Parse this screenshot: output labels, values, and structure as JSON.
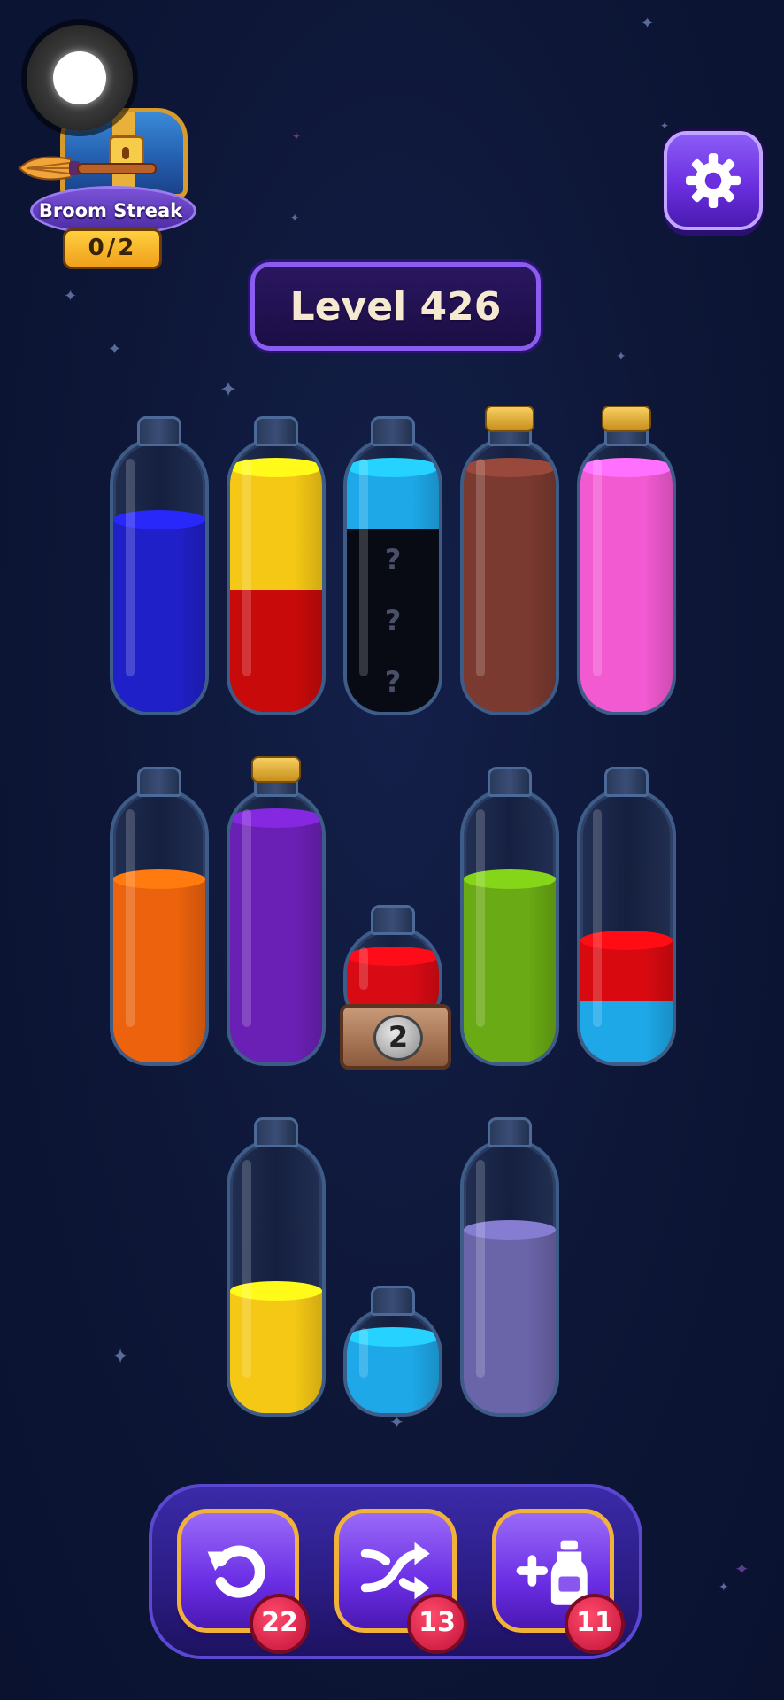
{
  "header": {
    "streak_label": "Broom Streak",
    "streak_count": "0/2",
    "level_label": "Level 426"
  },
  "icons": {
    "settings": "gear-icon",
    "undo": "undo-icon",
    "shuffle": "shuffle-icon",
    "add_bottle": "add-bottle-icon",
    "record": "record-icon",
    "chest": "treasure-chest-icon"
  },
  "bottles": [
    {
      "id": "b1",
      "corked": false,
      "capacity": 4,
      "layers": [
        {
          "color": "#2020c8",
          "units": 3.15
        }
      ]
    },
    {
      "id": "b2",
      "corked": false,
      "capacity": 4,
      "layers": [
        {
          "color": "#c80a0a",
          "units": 2
        },
        {
          "color": "#f5c815",
          "units": 2
        }
      ]
    },
    {
      "id": "b3",
      "corked": false,
      "capacity": 4,
      "layers": [
        {
          "hidden": true,
          "units": 1
        },
        {
          "hidden": true,
          "units": 1
        },
        {
          "hidden": true,
          "units": 1
        },
        {
          "color": "#1ea8e8",
          "units": 1
        }
      ]
    },
    {
      "id": "b4",
      "corked": true,
      "capacity": 4,
      "layers": [
        {
          "color": "#7a3a30",
          "units": 4
        }
      ]
    },
    {
      "id": "b5",
      "corked": true,
      "capacity": 4,
      "layers": [
        {
          "color": "#f25ad2",
          "units": 4
        }
      ]
    },
    {
      "id": "b6",
      "corked": false,
      "capacity": 4,
      "layers": [
        {
          "color": "#ec620d",
          "units": 3
        }
      ]
    },
    {
      "id": "b7",
      "corked": true,
      "capacity": 4,
      "layers": [
        {
          "color": "#6a20b4",
          "units": 4
        }
      ]
    },
    {
      "id": "b8",
      "corked": false,
      "capacity": 4,
      "layers": [
        {
          "color": "#6aaa14",
          "units": 3
        }
      ]
    },
    {
      "id": "b9",
      "corked": false,
      "capacity": 4,
      "layers": [
        {
          "color": "#1ea8e8",
          "units": 1
        },
        {
          "color": "#d80a10",
          "units": 1
        }
      ]
    },
    {
      "id": "b10",
      "corked": false,
      "capacity": 4,
      "layers": [
        {
          "color": "#f5c815",
          "units": 2
        }
      ]
    },
    {
      "id": "b11",
      "corked": false,
      "capacity": 4,
      "layers": [
        {
          "color": "#6a64a8",
          "units": 3
        }
      ]
    },
    {
      "id": "small1",
      "corked": false,
      "capacity": 1,
      "locked": true,
      "lock_count": "2",
      "layers": [
        {
          "color": "#d80a14",
          "units": 1
        }
      ]
    },
    {
      "id": "small2",
      "corked": false,
      "capacity": 1,
      "layers": [
        {
          "color": "#1ea8e8",
          "units": 1
        }
      ]
    }
  ],
  "hidden_mark": "?",
  "powerups": [
    {
      "name": "undo",
      "count": "22"
    },
    {
      "name": "shuffle",
      "count": "13"
    },
    {
      "name": "add-bottle",
      "count": "11"
    }
  ]
}
